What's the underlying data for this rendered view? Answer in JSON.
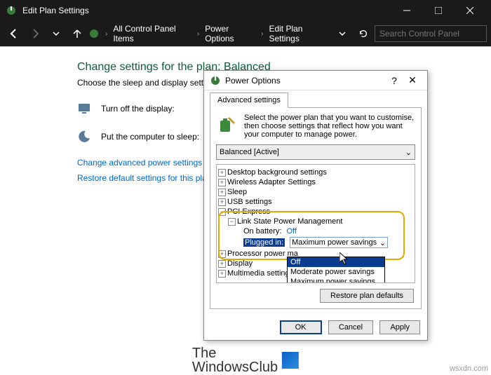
{
  "window": {
    "title": "Edit Plan Settings",
    "breadcrumbs": [
      "All Control Panel Items",
      "Power Options",
      "Edit Plan Settings"
    ],
    "search_placeholder": "Search Control Panel"
  },
  "page": {
    "heading": "Change settings for the plan: Balanced",
    "description": "Choose the sleep and display settings that you want your computer to use.",
    "row_display": "Turn off the display:",
    "row_sleep": "Put the computer to sleep:",
    "link_advanced": "Change advanced power settings",
    "link_restore": "Restore default settings for this plan"
  },
  "dialog": {
    "title": "Power Options",
    "tab": "Advanced settings",
    "desc": "Select the power plan that you want to customise, then choose settings that reflect how you want your computer to manage power.",
    "plan": "Balanced [Active]",
    "tree": {
      "desktop_bg": "Desktop background settings",
      "wireless": "Wireless Adapter Settings",
      "sleep": "Sleep",
      "usb": "USB settings",
      "pci": "PCI Express",
      "link_state": "Link State Power Management",
      "on_battery_lbl": "On battery:",
      "on_battery_val": "Off",
      "plugged_lbl": "Plugged in:",
      "plugged_val": "Maximum power savings",
      "processor": "Processor power ma",
      "display": "Display",
      "multimedia": "Multimedia settings"
    },
    "dropdown": {
      "opt_off": "Off",
      "opt_mod": "Moderate power savings",
      "opt_max": "Maximum power savings"
    },
    "restore_btn": "Restore plan defaults",
    "ok": "OK",
    "cancel": "Cancel",
    "apply": "Apply"
  },
  "footer": {
    "brand1": "The",
    "brand2": "WindowsClub",
    "site": "wsxdn.com"
  }
}
